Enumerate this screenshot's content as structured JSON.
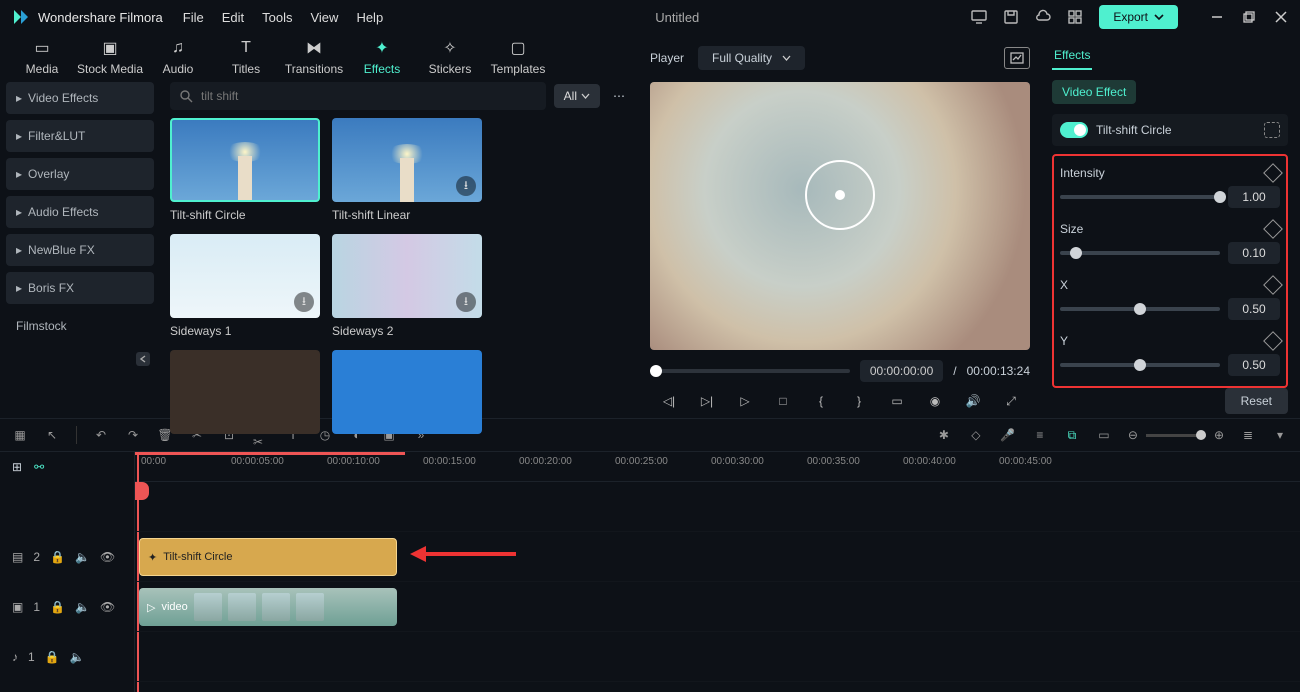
{
  "app": {
    "name": "Wondershare Filmora",
    "document": "Untitled"
  },
  "menu": [
    "File",
    "Edit",
    "Tools",
    "View",
    "Help"
  ],
  "export_label": "Export",
  "main_tabs": [
    {
      "label": "Media"
    },
    {
      "label": "Stock Media"
    },
    {
      "label": "Audio"
    },
    {
      "label": "Titles"
    },
    {
      "label": "Transitions"
    },
    {
      "label": "Effects"
    },
    {
      "label": "Stickers"
    },
    {
      "label": "Templates"
    }
  ],
  "active_main_tab": "Effects",
  "sidebar": {
    "items": [
      {
        "label": "Video Effects"
      },
      {
        "label": "Filter&LUT"
      },
      {
        "label": "Overlay"
      },
      {
        "label": "Audio Effects"
      },
      {
        "label": "NewBlue FX"
      },
      {
        "label": "Boris FX"
      }
    ],
    "filmstock": "Filmstock"
  },
  "search": {
    "placeholder": "tilt shift",
    "filter": "All"
  },
  "library_items": [
    {
      "label": "Tilt-shift Circle",
      "selected": true,
      "kind": "sky"
    },
    {
      "label": "Tilt-shift Linear",
      "selected": false,
      "kind": "sky",
      "dl": true
    },
    {
      "label": "Sideways 1",
      "selected": false,
      "kind": "snow",
      "dl": true
    },
    {
      "label": "Sideways 2",
      "selected": false,
      "kind": "glitch",
      "dl": true
    }
  ],
  "player": {
    "label": "Player",
    "quality": "Full Quality",
    "time_current": "00:00:00:00",
    "time_total": "00:00:13:24",
    "sep": "/"
  },
  "panel": {
    "tab": "Effects",
    "chip": "Video Effect",
    "effect_name": "Tilt-shift Circle",
    "reset": "Reset",
    "props": [
      {
        "name": "Intensity",
        "value": "1.00",
        "pos": 100
      },
      {
        "name": "Size",
        "value": "0.10",
        "pos": 10
      },
      {
        "name": "X",
        "value": "0.50",
        "pos": 50
      },
      {
        "name": "Y",
        "value": "0.50",
        "pos": 50
      }
    ]
  },
  "ruler": [
    "00:00",
    "00:00:05:00",
    "00:00:10:00",
    "00:00:15:00",
    "00:00:20:00",
    "00:00:25:00",
    "00:00:30:00",
    "00:00:35:00",
    "00:00:40:00",
    "00:00:45:00"
  ],
  "clips": {
    "fx": "Tilt-shift Circle",
    "vid": "video"
  },
  "track_nums": {
    "fx": "2",
    "vid": "1",
    "aud": "1"
  }
}
